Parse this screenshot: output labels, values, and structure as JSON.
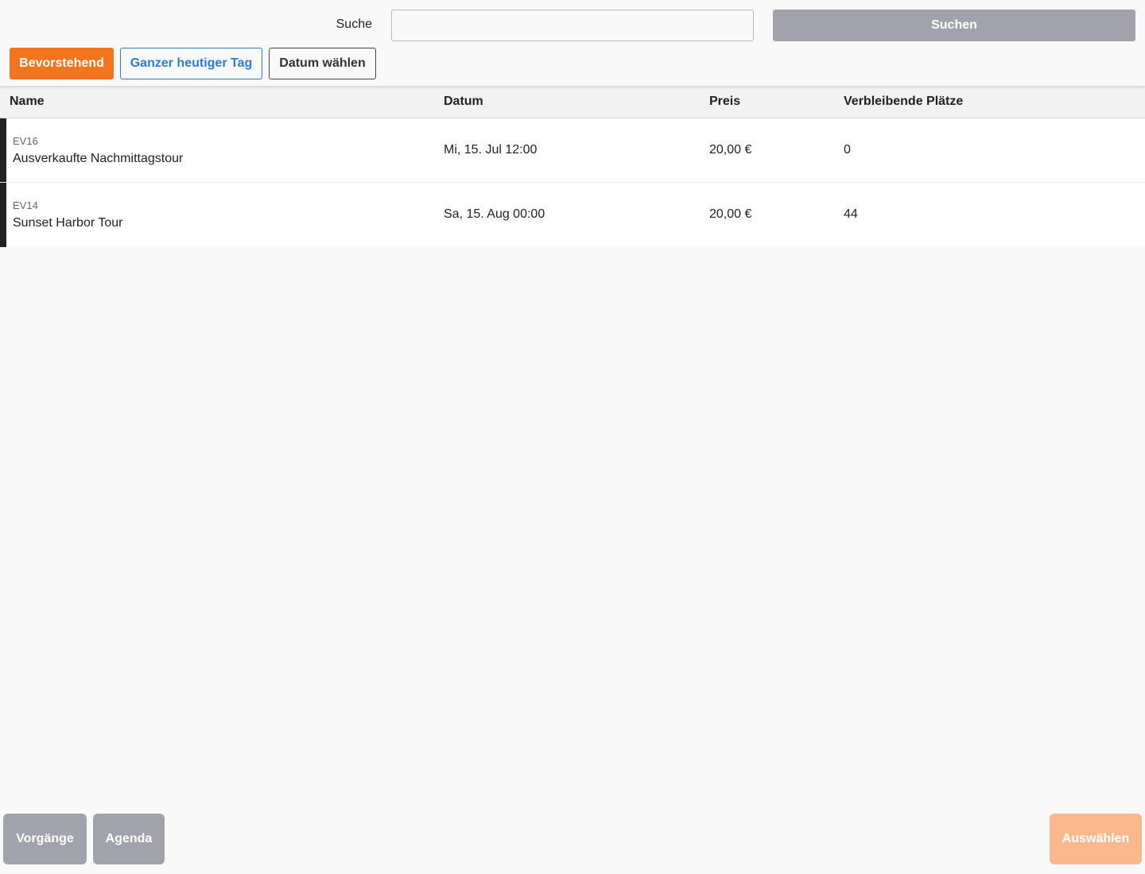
{
  "search": {
    "label": "Suche",
    "value": "",
    "placeholder": "",
    "button_label": "Suchen"
  },
  "filters": {
    "upcoming": "Bevorstehend",
    "today": "Ganzer heutiger Tag",
    "pick_date": "Datum wählen",
    "active": "upcoming"
  },
  "table": {
    "headers": {
      "name": "Name",
      "date": "Datum",
      "price": "Preis",
      "seats": "Verbleibende Plätze"
    },
    "rows": [
      {
        "code": "EV16",
        "name": "Ausverkaufte Nachmittagstour",
        "date": "Mi, 15. Jul 12:00",
        "price": "20,00 €",
        "seats": "0"
      },
      {
        "code": "EV14",
        "name": "Sunset Harbor Tour",
        "date": "Sa, 15. Aug 00:00",
        "price": "20,00 €",
        "seats": "44"
      }
    ]
  },
  "footer": {
    "transactions": "Vorgänge",
    "agenda": "Agenda",
    "select": "Auswählen"
  },
  "colors": {
    "accent": "#f5741e",
    "link": "#2e7bd6",
    "neutral_button": "#a2a2aa",
    "select_disabled": "#f9b98c"
  }
}
